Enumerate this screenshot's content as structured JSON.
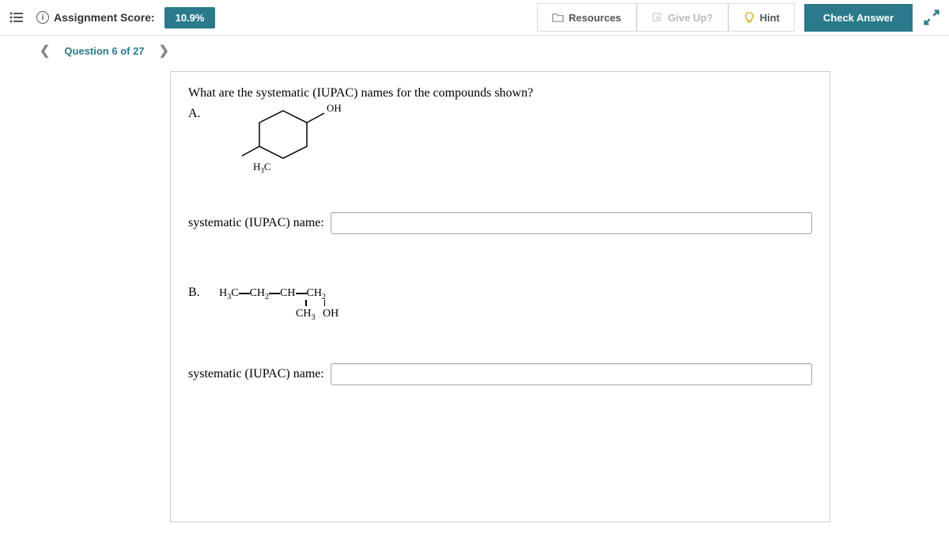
{
  "header": {
    "score_label": "Assignment Score:",
    "score_value": "10.9%",
    "resources": "Resources",
    "give_up": "Give Up?",
    "hint": "Hint",
    "check_answer": "Check Answer"
  },
  "nav": {
    "question_label": "Question 6 of 27"
  },
  "question": {
    "prompt": "What are the systematic (IUPAC) names for the compounds shown?",
    "part_a": "A.",
    "part_b": "B.",
    "oh_label": "OH",
    "h3c_label_prefix": "H",
    "h3c_label_suffix": "C",
    "input_label": "systematic (IUPAC) name:",
    "struct_b_line1_p1": "H",
    "struct_b_line1_p2": "C",
    "struct_b_line1_p3": "CH",
    "struct_b_line1_p4": "CH",
    "struct_b_line1_p5": "CH",
    "struct_b_line2_p1": "CH",
    "struct_b_line2_p2": "OH",
    "answer_a": "",
    "answer_b": ""
  }
}
